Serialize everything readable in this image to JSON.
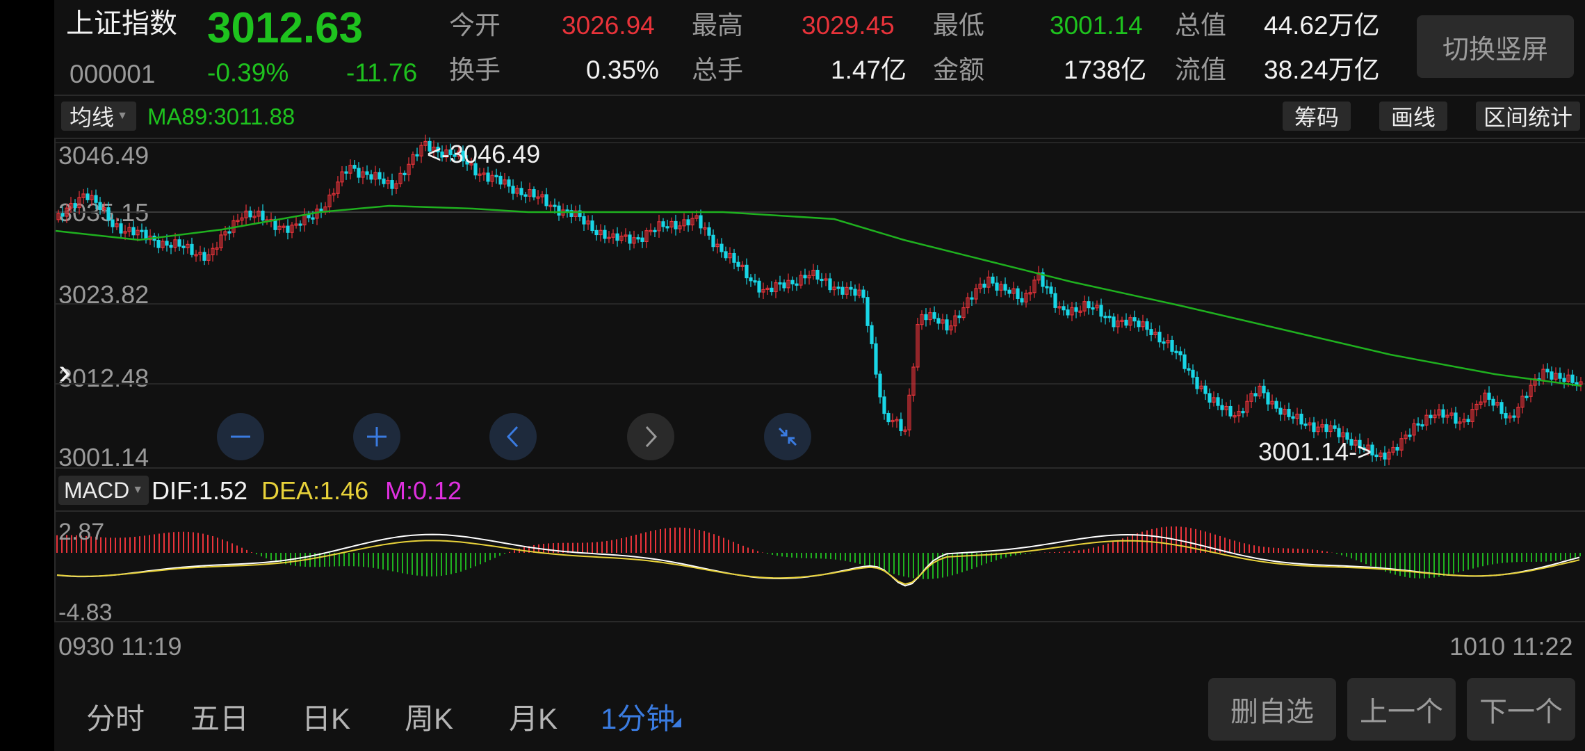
{
  "header": {
    "name": "上证指数",
    "price": "3012.63",
    "code": "000001",
    "change_pct": "-0.39%",
    "change": "-11.76",
    "stats": [
      {
        "label": "今开",
        "value": "3026.94",
        "tone": "red"
      },
      {
        "label": "最高",
        "value": "3029.45",
        "tone": "red"
      },
      {
        "label": "最低",
        "value": "3001.14",
        "tone": "green"
      },
      {
        "label": "总值",
        "value": "44.62万亿",
        "tone": "white"
      },
      {
        "label": "换手",
        "value": "0.35%",
        "tone": "white"
      },
      {
        "label": "总手",
        "value": "1.47亿",
        "tone": "white"
      },
      {
        "label": "金额",
        "value": "1738亿",
        "tone": "white"
      },
      {
        "label": "流值",
        "value": "38.24万亿",
        "tone": "white"
      }
    ],
    "switch_label": "切换竖屏"
  },
  "toolbar": {
    "ma_select": "均线",
    "ma_value": "MA89:3011.88",
    "chips_label": "筹码",
    "draw_label": "画线",
    "range_label": "区间统计"
  },
  "kline": {
    "y_labels": [
      "3046.49",
      "3035.15",
      "3023.82",
      "3012.48",
      "3001.14"
    ],
    "high_marker": "<-3046.49",
    "low_marker": "3001.14->"
  },
  "macd": {
    "select": "MACD",
    "dif": "DIF:1.52",
    "dea": "DEA:1.46",
    "m": "M:0.12",
    "y_top": "2.87",
    "y_bottom": "-4.83"
  },
  "time_axis": {
    "start": "0930 11:19",
    "end": "1010 11:22"
  },
  "tabs": [
    "分时",
    "五日",
    "日K",
    "周K",
    "月K",
    "1分钟"
  ],
  "active_tab": "1分钟",
  "bottom_buttons": {
    "remove": "删自选",
    "prev": "上一个",
    "next": "下一个"
  },
  "icons": [
    "zoom-out-icon",
    "zoom-in-icon",
    "scroll-left-icon",
    "scroll-right-icon",
    "collapse-icon",
    "expand-panel-icon"
  ],
  "colors": {
    "up": "#e8333a",
    "down": "#19d6e6",
    "ma": "#1fb11f",
    "dea": "#e8d23a",
    "m": "#e030e0",
    "active": "#3a7be0"
  },
  "chart_data": {
    "type": "candlestick",
    "ylim": [
      3001.14,
      3046.49
    ],
    "ma_series": {
      "name": "MA89",
      "last": 3011.88
    },
    "high": 3046.49,
    "low": 3001.14,
    "macd_ylim": [
      -4.83,
      2.87
    ],
    "macd_last": {
      "dif": 1.52,
      "dea": 1.46,
      "m": 0.12
    }
  }
}
